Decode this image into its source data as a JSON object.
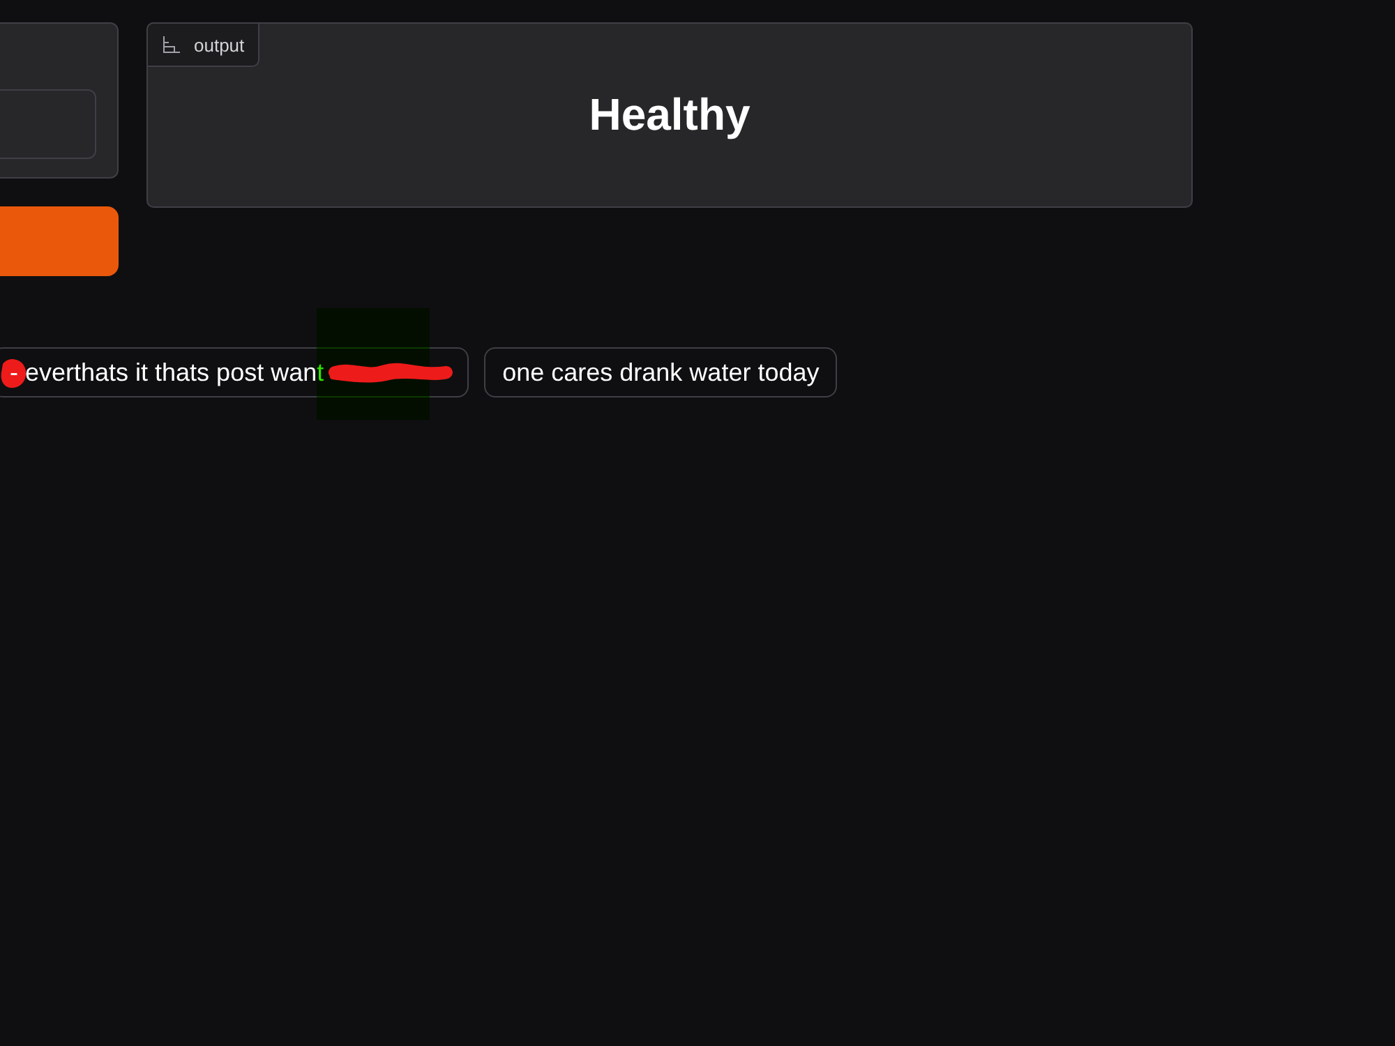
{
  "output": {
    "label": "output",
    "value": "Healthy"
  },
  "examples": [
    {
      "text": "- everthats it thats post want",
      "redacted": true
    },
    {
      "text": "one cares drank water today",
      "redacted": false
    }
  ]
}
